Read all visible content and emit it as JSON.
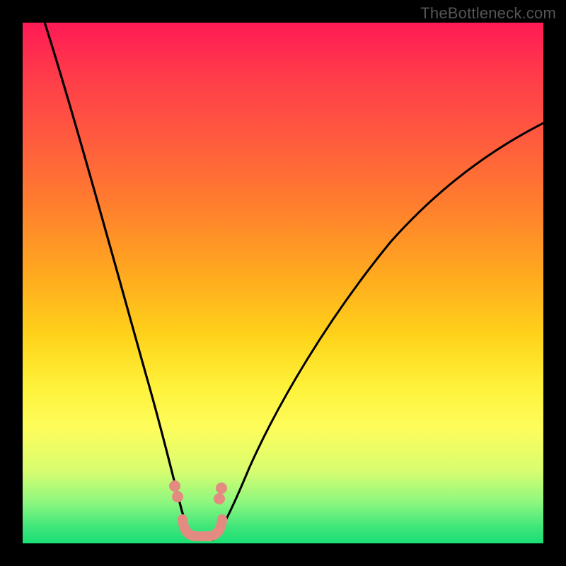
{
  "attribution": "TheBottleneck.com",
  "colors": {
    "frame": "#000000",
    "gradient_top": "#ff1a55",
    "gradient_bottom": "#1adf74",
    "curve": "#000000",
    "marker": "#e38b81"
  },
  "chart_data": {
    "type": "line",
    "title": "",
    "xlabel": "",
    "ylabel": "",
    "xlim": [
      0,
      100
    ],
    "ylim": [
      0,
      100
    ],
    "series": [
      {
        "name": "left_curve",
        "x": [
          3,
          6,
          10,
          14,
          18,
          22,
          25,
          28,
          30,
          32
        ],
        "values": [
          100,
          87,
          70,
          55,
          40,
          25,
          14,
          7,
          3,
          0
        ]
      },
      {
        "name": "right_curve",
        "x": [
          36,
          40,
          46,
          54,
          62,
          72,
          82,
          92,
          100
        ],
        "values": [
          0,
          6,
          18,
          34,
          50,
          62,
          72,
          78,
          82
        ]
      }
    ],
    "markers": [
      {
        "x_hint": 28,
        "y_hint": 13,
        "type": "dot"
      },
      {
        "x_hint": 29,
        "y_hint": 11,
        "type": "dot"
      },
      {
        "x_hint": 37,
        "y_hint": 12,
        "type": "dot"
      },
      {
        "x_hint": 37.5,
        "y_hint": 14,
        "type": "dot"
      }
    ],
    "marker_bridge": {
      "x_hint": [
        30,
        36
      ],
      "y_hint": 1.5
    },
    "notes": "Axes are unlabeled; values estimated from pixel positions on a 0-100 normalized scale. The curve appears to be a V-shaped bottleneck profile with minimum near x≈34."
  }
}
